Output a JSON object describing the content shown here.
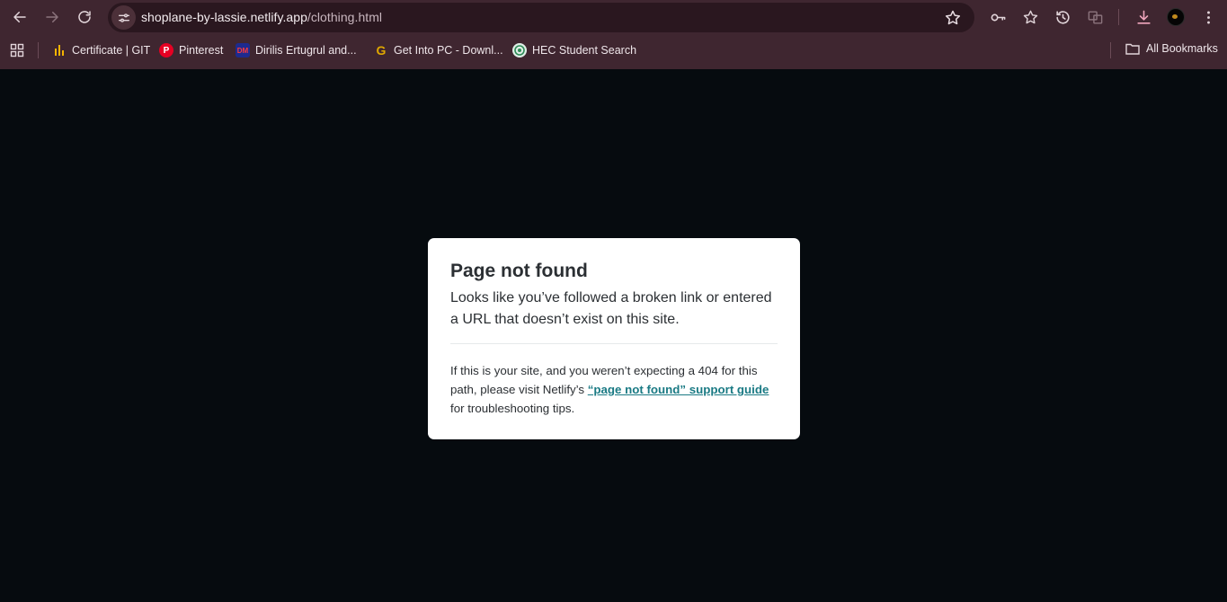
{
  "browser": {
    "url_host": "shoplane-by-lassie.netlify.app",
    "url_path": "/clothing.html",
    "bookmarks": [
      {
        "label": "Certificate | GIT",
        "icon": "git-chart-favicon",
        "color": "#f4b400"
      },
      {
        "label": "Pinterest",
        "icon": "pinterest-favicon",
        "color": "#e60023"
      },
      {
        "label": "Dirilis Ertugrul and...",
        "icon": "dm-favicon",
        "color": "#d7263d"
      },
      {
        "label": "Get Into PC - Downl...",
        "icon": "g-favicon",
        "color": "#e0a800"
      },
      {
        "label": "HEC Student Search",
        "icon": "hec-favicon",
        "color": "#2e8b57"
      }
    ],
    "all_bookmarks_label": "All Bookmarks",
    "bookmark_icon_glyphs": {
      "dm": "DM",
      "g": "G",
      "p": "P"
    }
  },
  "page": {
    "title": "Page not found",
    "lead": "Looks like you’ve followed a broken link or entered a URL that doesn’t exist on this site.",
    "note_before": "If this is your site, and you weren’t expecting a 404 for this path, please visit Netlify’s ",
    "note_link": "“page not found” support guide",
    "note_after": " for troubleshooting tips."
  },
  "colors": {
    "chrome": "#3f2630",
    "page_background": "#060b0f",
    "card": "#ffffff",
    "link": "#1a7a84"
  }
}
